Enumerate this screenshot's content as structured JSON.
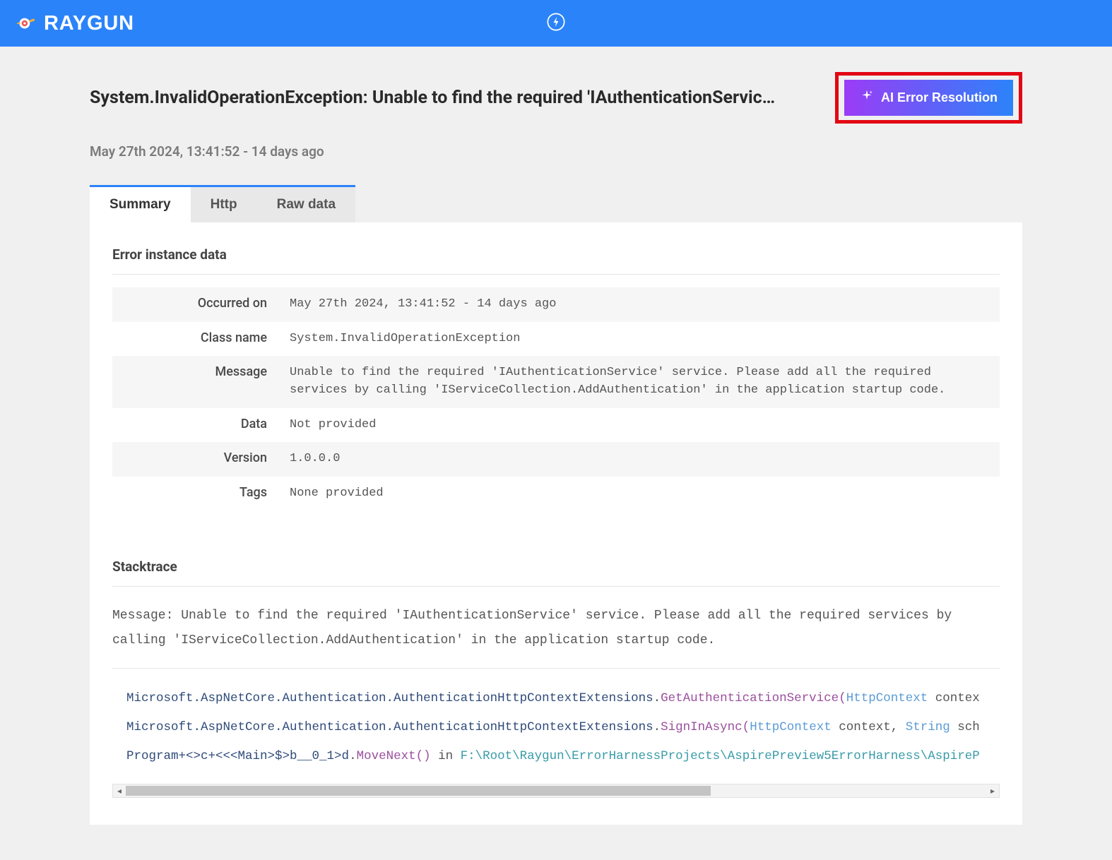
{
  "brand": "RAYGUN",
  "header": {
    "title": "System.InvalidOperationException: Unable to find the required 'IAuthenticationServic…",
    "ai_button_label": "AI Error Resolution",
    "timestamp": "May 27th 2024, 13:41:52 - 14 days ago"
  },
  "tabs": [
    {
      "label": "Summary",
      "active": true
    },
    {
      "label": "Http",
      "active": false
    },
    {
      "label": "Raw data",
      "active": false
    }
  ],
  "error_instance": {
    "section_title": "Error instance data",
    "rows": [
      {
        "key": "Occurred on",
        "value": "May 27th 2024, 13:41:52 - 14 days ago"
      },
      {
        "key": "Class name",
        "value": "System.InvalidOperationException"
      },
      {
        "key": "Message",
        "value": "Unable to find the required 'IAuthenticationService' service. Please add all the required services by calling 'IServiceCollection.AddAuthentication' in the application startup code."
      },
      {
        "key": "Data",
        "value": "Not provided"
      },
      {
        "key": "Version",
        "value": "1.0.0.0"
      },
      {
        "key": "Tags",
        "value": "None provided"
      }
    ]
  },
  "stacktrace": {
    "section_title": "Stacktrace",
    "message": "Message: Unable to find the required 'IAuthenticationService' service. Please add all the required services by calling 'IServiceCollection.AddAuthentication' in the application startup code.",
    "frames": [
      {
        "ns": "Microsoft.AspNetCore.Authentication.AuthenticationHttpContextExtensions",
        "method": "GetAuthenticationService",
        "sig_open": "(",
        "arg_type": "HttpContext",
        "arg_name": " contex"
      },
      {
        "ns": "Microsoft.AspNetCore.Authentication.AuthenticationHttpContextExtensions",
        "method": "SignInAsync",
        "sig_open": "(",
        "arg_type": "HttpContext",
        "arg_name": " context, ",
        "arg_type2": "String",
        "arg_name2": " sch"
      },
      {
        "ns_prefix": "Program+<>c+<<<Main>$>b__0_1>d",
        "method": "MoveNext",
        "sig": "()",
        "in": " in ",
        "path": "F:\\Root\\Raygun\\ErrorHarnessProjects\\AspirePreview5ErrorHarness\\AspireP"
      }
    ]
  }
}
